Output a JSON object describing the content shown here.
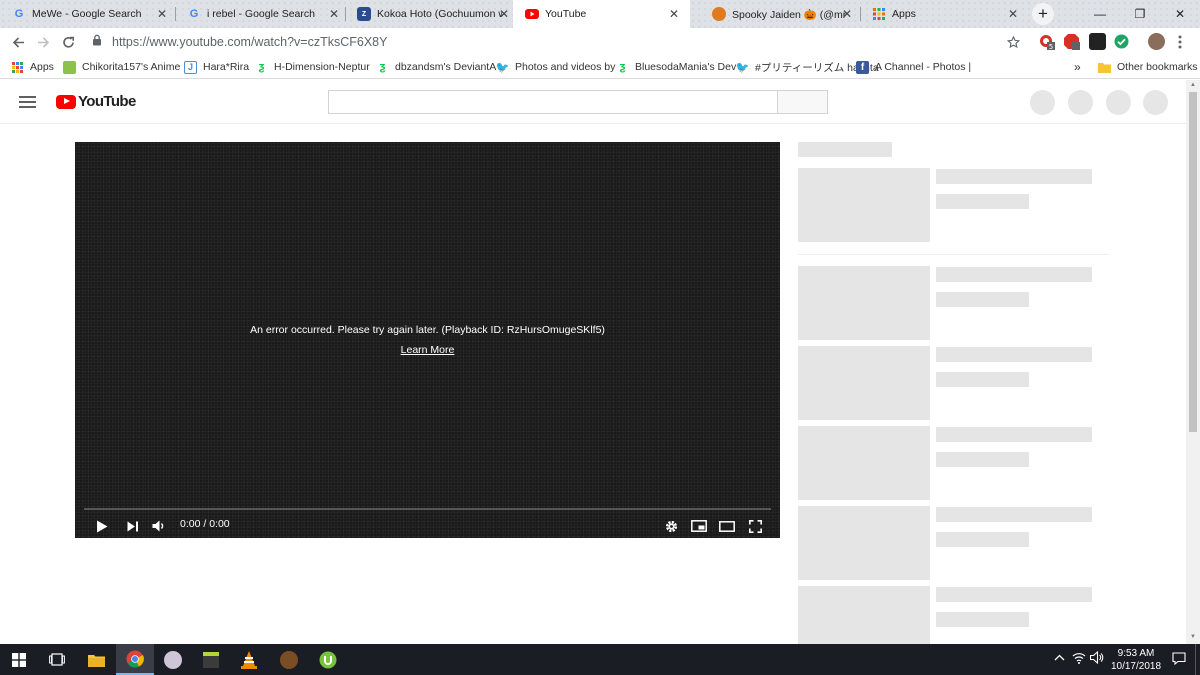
{
  "browser": {
    "tabs": [
      {
        "title": "MeWe - Google Search",
        "icon": "google-icon"
      },
      {
        "title": "i rebel - Google Search",
        "icon": "google-icon"
      },
      {
        "title": "Kokoa Hoto (Gochuumon wa",
        "icon": "zerochan-icon"
      },
      {
        "title": "YouTube",
        "icon": "youtube-icon",
        "active": true
      },
      {
        "title": "Spooky Jaiden 🎃 (@mr",
        "icon": "pumpkin-icon"
      },
      {
        "title": "Apps",
        "icon": "apps-grid-icon"
      }
    ],
    "url": "https://www.youtube.com/watch?v=czTksCF6X8Y",
    "bookmarks": [
      {
        "label": "Apps",
        "icon": "apps-grid-icon"
      },
      {
        "label": "Chikorita157's Anime",
        "icon": "bookmark-site-icon"
      },
      {
        "label": "Hara*Rira",
        "icon": "bookmark-site-icon"
      },
      {
        "label": "H-Dimension-Neptur",
        "icon": "deviantart-icon"
      },
      {
        "label": "dbzandsm's DeviantA",
        "icon": "deviantart-icon"
      },
      {
        "label": "Photos and videos by",
        "icon": "twitter-icon"
      },
      {
        "label": "BluesodaMania's Dev",
        "icon": "deviantart-icon"
      },
      {
        "label": "#プリティーリズム hashta",
        "icon": "twitter-icon"
      },
      {
        "label": "A Channel - Photos |",
        "icon": "facebook-icon"
      }
    ],
    "more_bookmarks": "»",
    "other_bookmarks": "Other bookmarks",
    "ext_badge_count": "5"
  },
  "youtube": {
    "logo_text": "YouTube",
    "search_placeholder": "",
    "player": {
      "error_message": "An error occurred. Please try again later. (Playback ID: RzHursOmugeSKlf5)",
      "learn_more": "Learn More",
      "time": "0:00 / 0:00"
    }
  },
  "taskbar": {
    "time": "9:53 AM",
    "date": "10/17/2018"
  },
  "colors": {
    "youtube_red": "#ff0000",
    "skeleton": "#e5e5e5",
    "player_bg": "#1a1a1a",
    "taskbar": "#1b1d24"
  }
}
